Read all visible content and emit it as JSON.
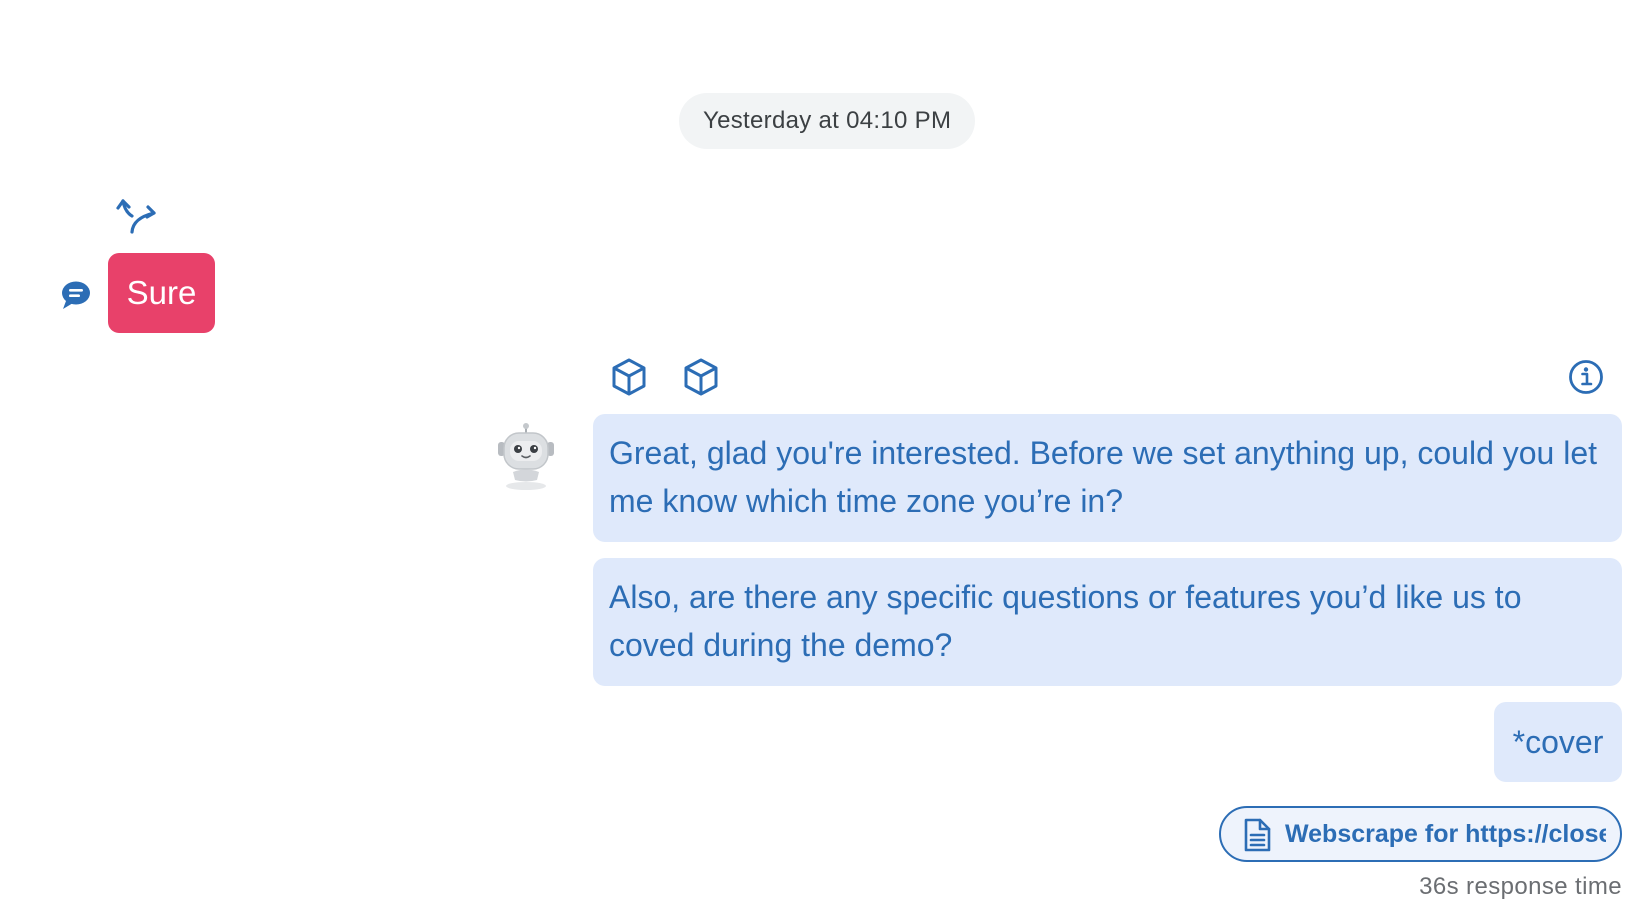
{
  "conversation": {
    "timestamp": "Yesterday at 04:10 PM",
    "user_message": {
      "text": "Sure"
    },
    "bot_messages": [
      {
        "text": "Great, glad you're interested. Before we set anything up, could you let me know which time zone you’re in?"
      },
      {
        "text": "Also, are there any specific questions or features you’d like us to coved during the demo?"
      },
      {
        "text": "*cover"
      }
    ],
    "attachment": {
      "label": "Webscrape for https://close",
      "icon": "document-icon"
    },
    "response_time": "36s response time"
  },
  "icons": {
    "reply": "reply-arrows-icon",
    "channel": "chat-bubble-icon",
    "tool_1": "cube-icon",
    "tool_2": "cube-icon",
    "info": "info-icon",
    "avatar": "robot-avatar"
  },
  "colors": {
    "user_bubble": "#e8416a",
    "bot_bubble": "#dfe9fb",
    "accent": "#2c6db5",
    "timestamp_pill": "#f2f4f5",
    "muted_text": "#6b6e72"
  }
}
